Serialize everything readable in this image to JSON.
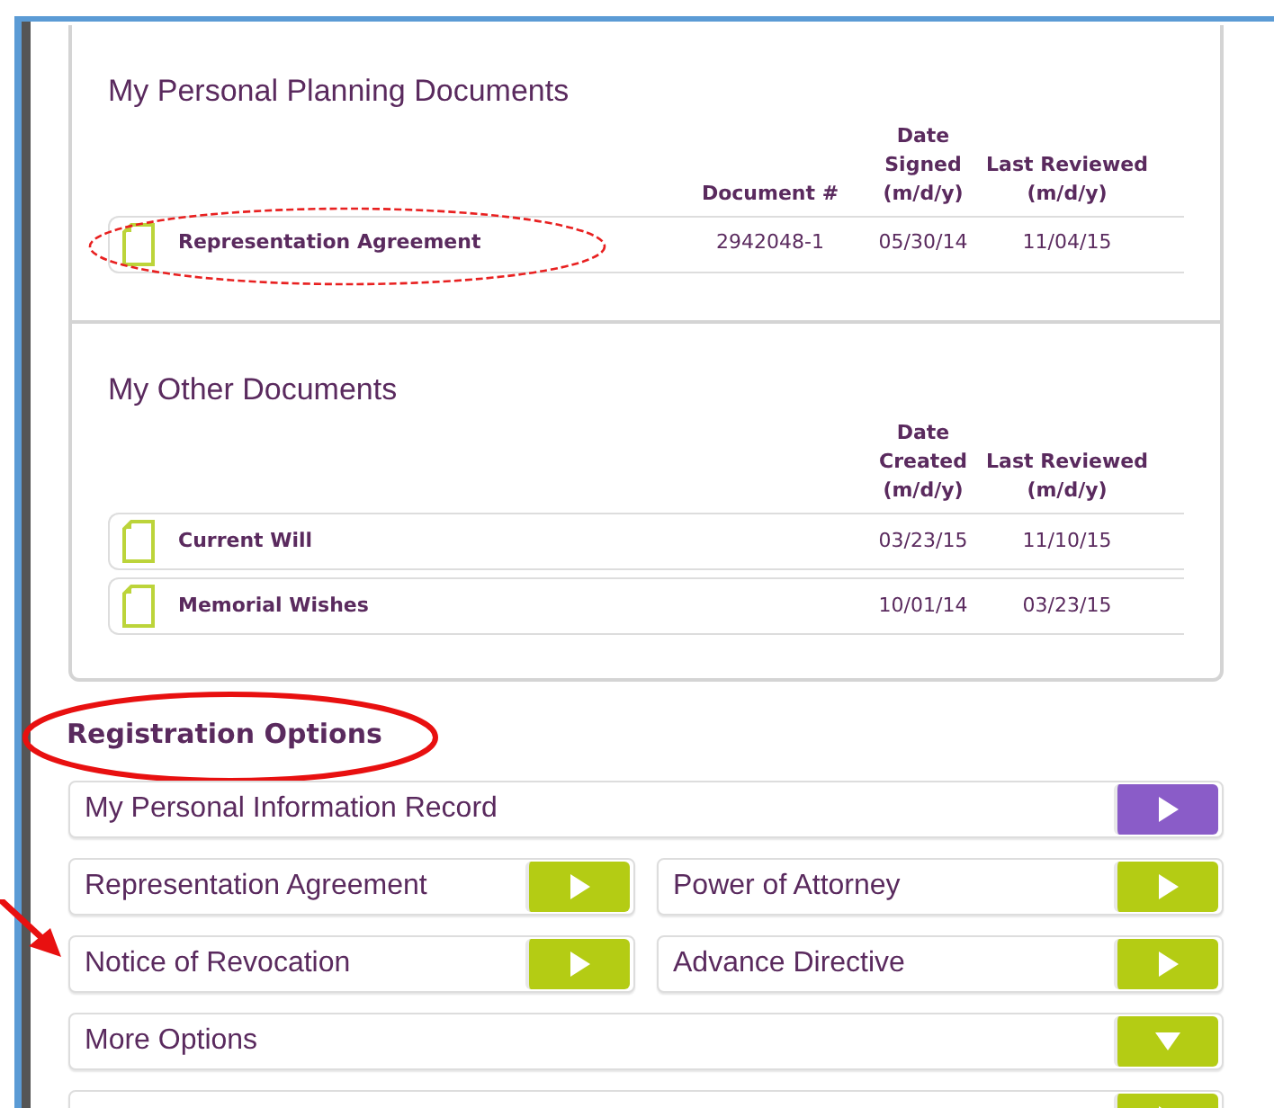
{
  "planning": {
    "title": "My Personal Planning Documents",
    "columns": [
      "Document #",
      "Date Signed (m/d/y)",
      "Last Reviewed (m/d/y)"
    ],
    "rows": [
      {
        "name": "Representation Agreement",
        "cells": [
          "2942048-1",
          "05/30/14",
          "11/04/15"
        ],
        "circled": true
      }
    ]
  },
  "other": {
    "title": "My Other Documents",
    "columns": [
      "Date Created (m/d/y)",
      "Last Reviewed (m/d/y)"
    ],
    "rows": [
      {
        "name": "Current Will",
        "cells": [
          "03/23/15",
          "11/10/15"
        ],
        "circled": false
      },
      {
        "name": "Memorial Wishes",
        "cells": [
          "10/01/14",
          "03/23/15"
        ],
        "circled": false
      }
    ]
  },
  "registration": {
    "title": "Registration Options",
    "circled": true,
    "rows": [
      [
        {
          "label": "My Personal Information Record",
          "kind": "open",
          "color": "#8a5cc8"
        }
      ],
      [
        {
          "label": "Representation Agreement",
          "kind": "open",
          "color": "#b4cc14"
        },
        {
          "label": "Power of Attorney",
          "kind": "open",
          "color": "#b4cc14"
        }
      ],
      [
        {
          "label": "Notice of Revocation",
          "kind": "open",
          "color": "#b4cc14",
          "pointed": true
        },
        {
          "label": "Advance Directive",
          "kind": "open",
          "color": "#b4cc14"
        }
      ],
      [
        {
          "label": "More Options",
          "kind": "expand",
          "color": "#b4cc14"
        }
      ],
      [
        {
          "kind": "open",
          "color": "#b4cc14"
        }
      ]
    ]
  }
}
